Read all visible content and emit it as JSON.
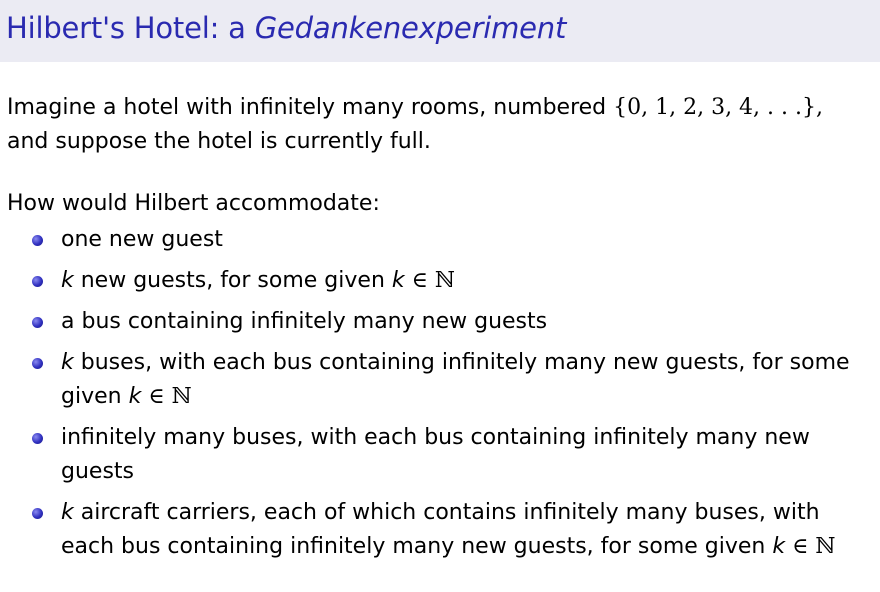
{
  "slide": {
    "title_prefix": "Hilbert's Hotel: a ",
    "title_emphasis": "Gedankenexperiment",
    "intro_line1": "Imagine a hotel with infinitely many rooms, numbered ",
    "intro_set": "{0, 1, 2, 3, 4, . . .},",
    "intro_line2": "and suppose the hotel is currently full.",
    "prompt": "How would Hilbert accommodate:"
  },
  "bullets": [
    {
      "text": "one new guest"
    },
    {
      "var": "k",
      "text": " new guests, for some given ",
      "var2": "k",
      "math": " ∈ ℕ"
    },
    {
      "text": "a bus containing infinitely many new guests"
    },
    {
      "var": "k",
      "text": " buses, with each bus containing infinitely many new guests, for some given ",
      "var2": "k",
      "math": " ∈ ℕ"
    },
    {
      "text": "infinitely many buses, with each bus containing infinitely many new guests"
    },
    {
      "var": "k",
      "text": " aircraft carriers, each of which contains infinitely many buses, with each bus containing infinitely many new guests, for some given ",
      "var2": "k",
      "math": " ∈ ℕ"
    }
  ],
  "colors": {
    "title": "#2a2ab0",
    "title_bar": "#ebebf3",
    "bullet": "#3030c0"
  }
}
